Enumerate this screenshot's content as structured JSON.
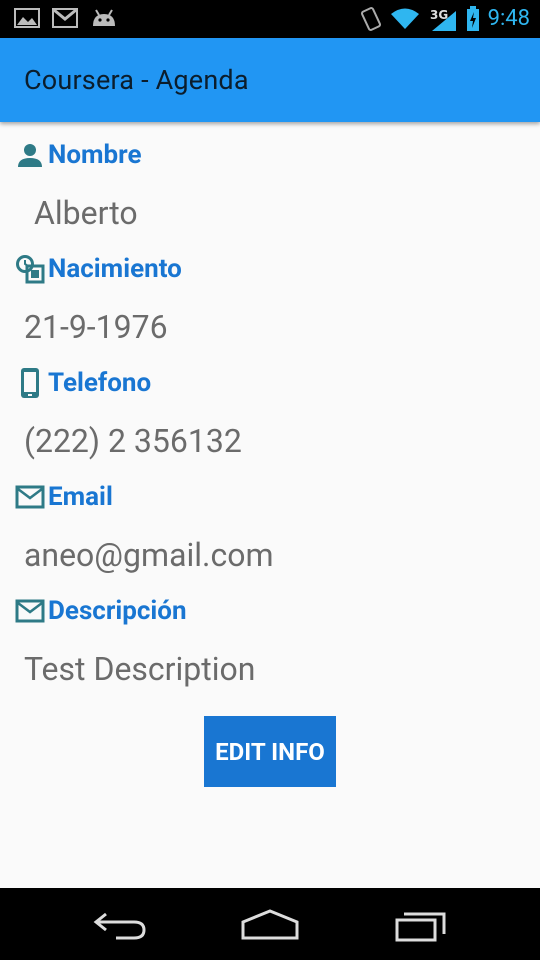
{
  "status_bar": {
    "time": "9:48",
    "network": "3G"
  },
  "app_bar": {
    "title": "Coursera - Agenda"
  },
  "fields": [
    {
      "label": "Nombre",
      "value": "Alberto",
      "icon": "person-icon"
    },
    {
      "label": "Nacimiento",
      "value": "21-9-1976",
      "icon": "calendar-clock-icon"
    },
    {
      "label": "Telefono",
      "value": "(222) 2 356132",
      "icon": "phone-icon"
    },
    {
      "label": "Email",
      "value": "aneo@gmail.com",
      "icon": "email-icon"
    },
    {
      "label": "Descripción",
      "value": "Test Description",
      "icon": "email-icon"
    }
  ],
  "edit_button": {
    "label": "EDIT INFO"
  },
  "colors": {
    "accent": "#2196f3",
    "label": "#1976d2",
    "icon": "#2e7a86",
    "value": "#6b6b6b"
  }
}
